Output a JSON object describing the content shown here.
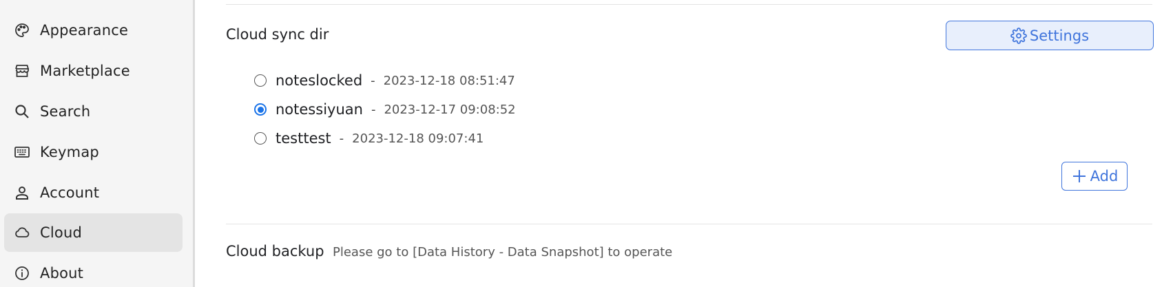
{
  "sidebar": {
    "items": [
      {
        "label": "Appearance",
        "icon": "palette-icon",
        "active": false
      },
      {
        "label": "Marketplace",
        "icon": "store-icon",
        "active": false
      },
      {
        "label": "Search",
        "icon": "search-icon",
        "active": false
      },
      {
        "label": "Keymap",
        "icon": "keyboard-icon",
        "active": false
      },
      {
        "label": "Account",
        "icon": "user-icon",
        "active": false
      },
      {
        "label": "Cloud",
        "icon": "cloud-icon",
        "active": true
      },
      {
        "label": "About",
        "icon": "info-icon",
        "active": false
      }
    ]
  },
  "cloud_sync": {
    "title": "Cloud sync dir",
    "settings_label": "Settings",
    "dirs": [
      {
        "name": "noteslocked",
        "separator": "-",
        "time": "2023-12-18 08:51:47",
        "selected": false
      },
      {
        "name": "notessiyuan",
        "separator": "-",
        "time": "2023-12-17 09:08:52",
        "selected": true
      },
      {
        "name": "testtest",
        "separator": "-",
        "time": "2023-12-18 09:07:41",
        "selected": false
      }
    ],
    "add_label": "Add"
  },
  "cloud_backup": {
    "title": "Cloud backup",
    "description": "Please go to [Data History - Data Snapshot] to operate"
  },
  "colors": {
    "accent": "#3f74dc",
    "radio_selected": "#1a73e8",
    "sidebar_bg": "#f5f5f5",
    "active_item_bg": "#e4e4e4"
  }
}
